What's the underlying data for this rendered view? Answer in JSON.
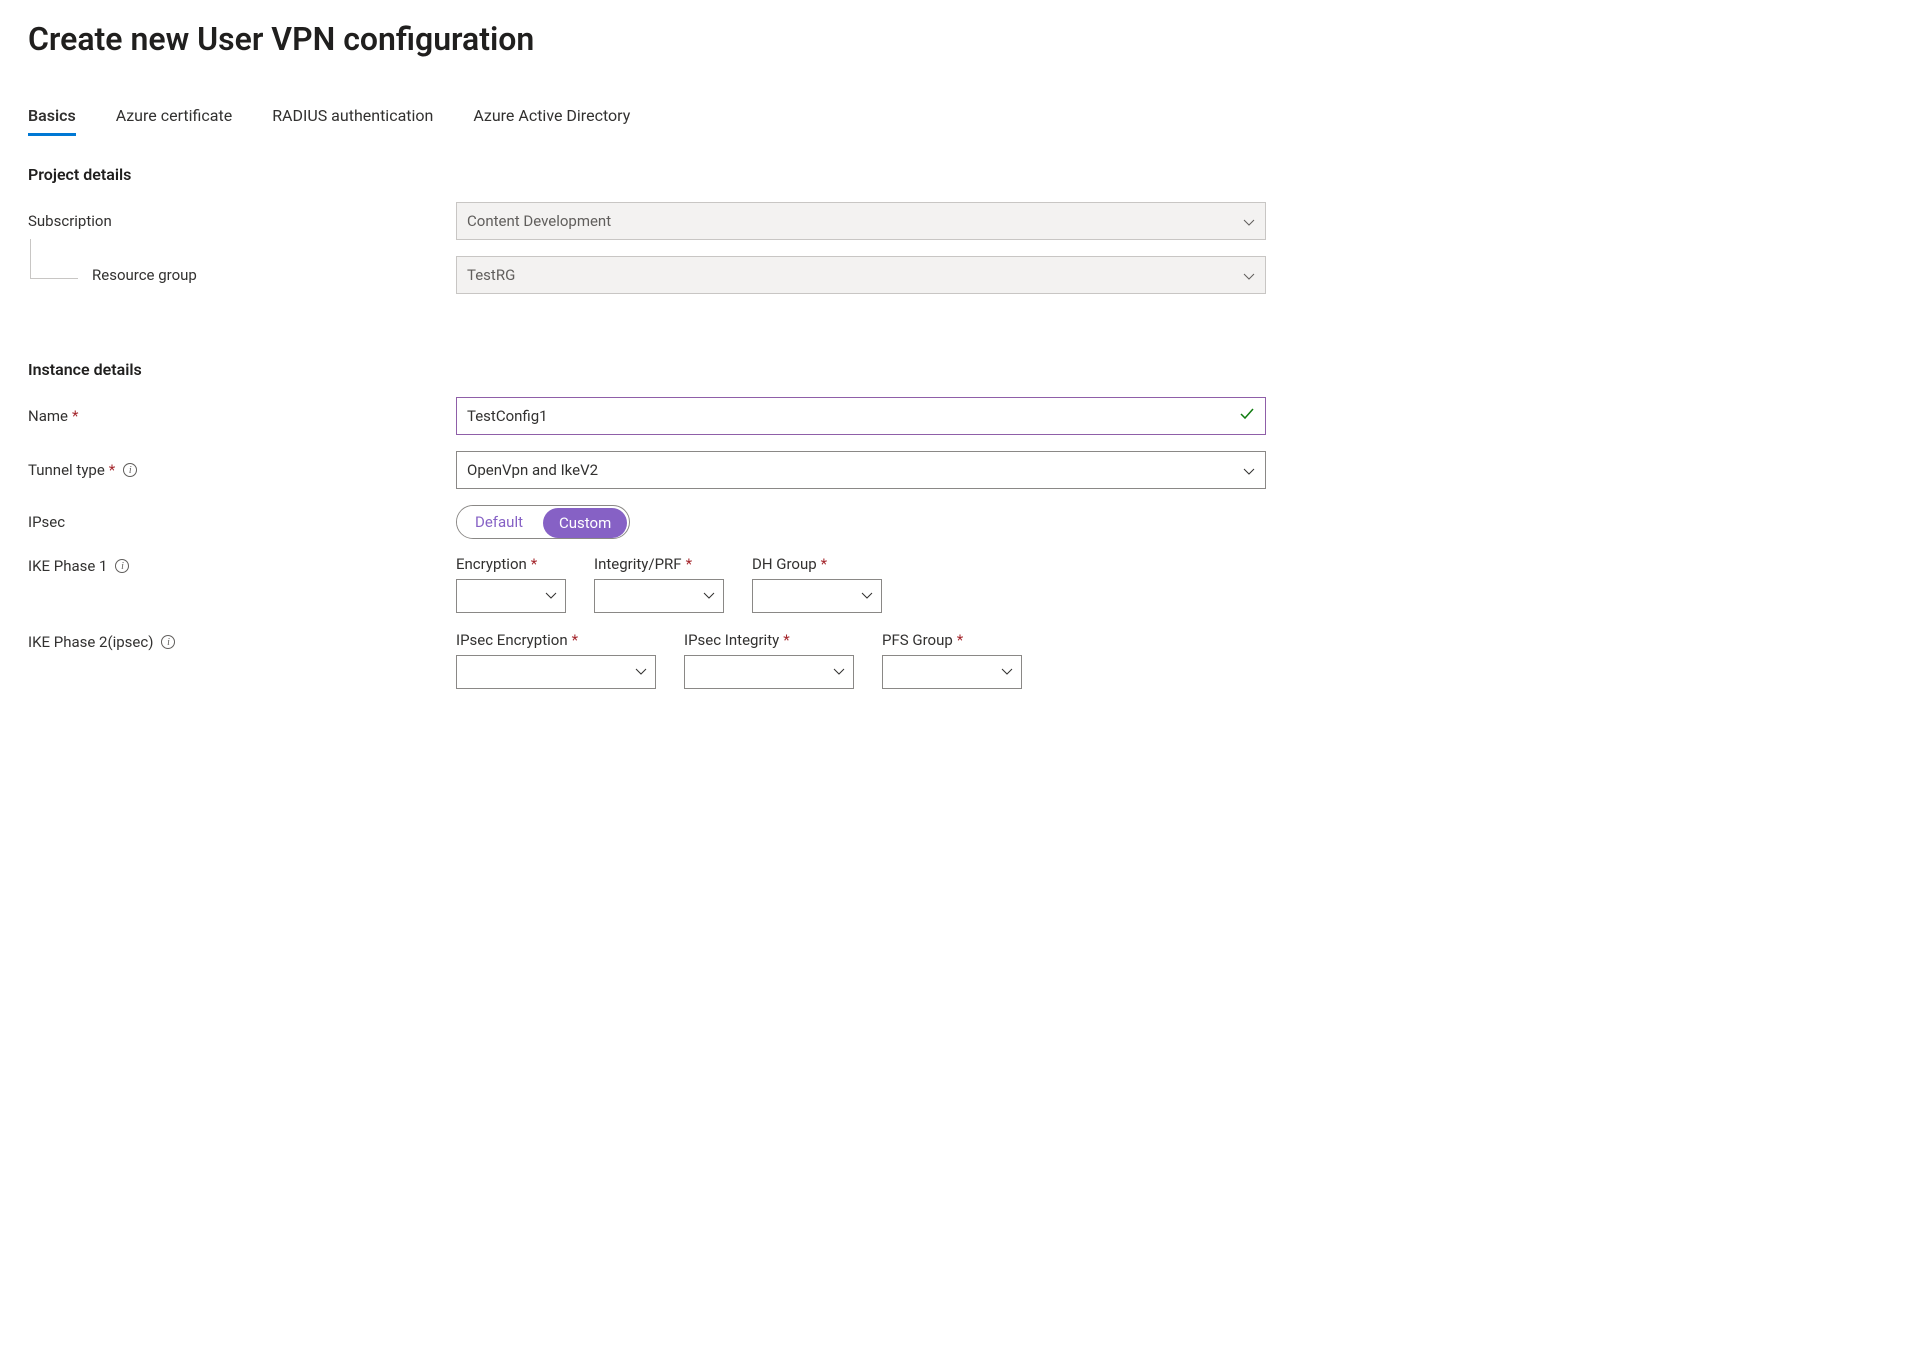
{
  "page": {
    "title": "Create new User VPN configuration"
  },
  "tabs": {
    "items": [
      {
        "label": "Basics",
        "active": true
      },
      {
        "label": "Azure certificate",
        "active": false
      },
      {
        "label": "RADIUS authentication",
        "active": false
      },
      {
        "label": "Azure Active Directory",
        "active": false
      }
    ]
  },
  "sections": {
    "project_details": {
      "title": "Project details",
      "subscription": {
        "label": "Subscription",
        "value": "Content Development"
      },
      "resource_group": {
        "label": "Resource group",
        "value": "TestRG"
      }
    },
    "instance_details": {
      "title": "Instance details",
      "name": {
        "label": "Name",
        "required": true,
        "value": "TestConfig1",
        "valid": true
      },
      "tunnel_type": {
        "label": "Tunnel type",
        "required": true,
        "has_info": true,
        "value": "OpenVpn and IkeV2"
      },
      "ipsec": {
        "label": "IPsec",
        "options": {
          "default": "Default",
          "custom": "Custom"
        },
        "selected": "custom"
      },
      "phase1": {
        "label": "IKE Phase 1",
        "has_info": true,
        "encryption": {
          "label": "Encryption",
          "required": true,
          "value": ""
        },
        "integrity": {
          "label": "Integrity/PRF",
          "required": true,
          "value": ""
        },
        "dh_group": {
          "label": "DH Group",
          "required": true,
          "value": ""
        }
      },
      "phase2": {
        "label": "IKE Phase 2(ipsec)",
        "has_info": true,
        "ipsec_encryption": {
          "label": "IPsec Encryption",
          "required": true,
          "value": ""
        },
        "ipsec_integrity": {
          "label": "IPsec Integrity",
          "required": true,
          "value": ""
        },
        "pfs_group": {
          "label": "PFS Group",
          "required": true,
          "value": ""
        }
      }
    }
  }
}
